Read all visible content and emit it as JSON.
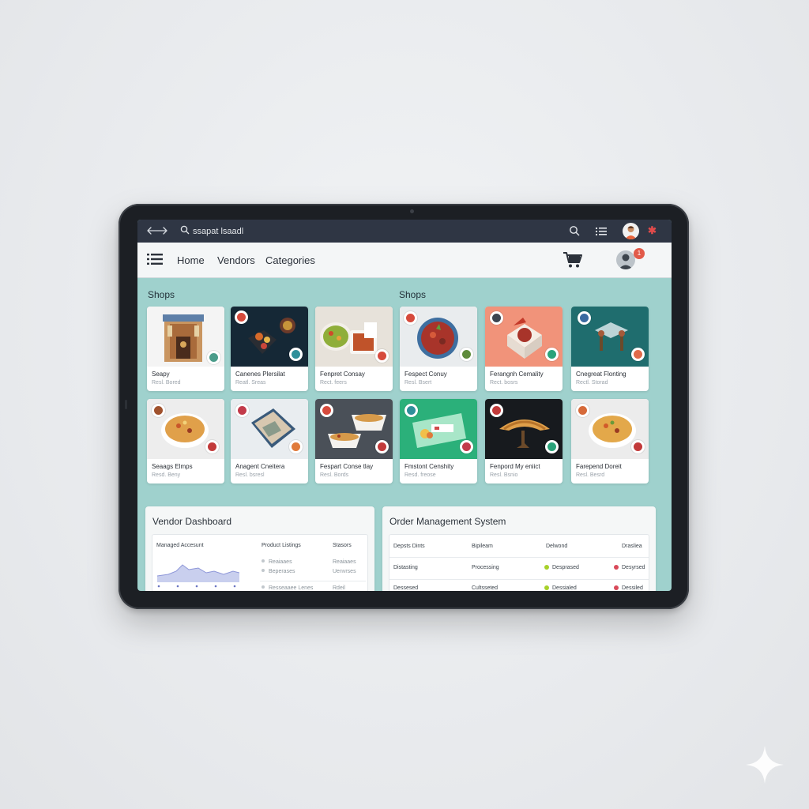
{
  "topbar": {
    "search_text": "ssapat lsaadl"
  },
  "nav": {
    "home": "Home",
    "vendors": "Vendors",
    "categories": "Categories",
    "notification_count": "1"
  },
  "sections": {
    "shops_left": "Shops",
    "shops_right": "Shops"
  },
  "cards": [
    {
      "title": "Seapy",
      "sub": "Resl. Bored",
      "badge_color": "#4a9c8a"
    },
    {
      "title": "Canenes Plersilat",
      "sub": "Reatl. Sreas",
      "badge_color": "#2f8f9a"
    },
    {
      "title": "Fenpret Consay",
      "sub": "Rect. feers",
      "badge_color": "#d64a3c"
    },
    {
      "title": "Fespect Conuy",
      "sub": "Resl. Bsert",
      "badge_color": "#5d8a3a"
    },
    {
      "title": "Ferangnh Cemality",
      "sub": "Rect. bosrs",
      "badge_color": "#2aa37a"
    },
    {
      "title": "Cnegreat Flonting",
      "sub": "Rectl. Storad",
      "badge_color": "#e06a4a"
    },
    {
      "title": "Seaags Elmps",
      "sub": "Resd. Beny",
      "badge_color": "#c23a3a"
    },
    {
      "title": "Anagent Cneitera",
      "sub": "Resl. bsresl",
      "badge_color": "#e07a3a"
    },
    {
      "title": "Fespart Conse tlay",
      "sub": "Resl. Bords",
      "badge_color": "#c23a3a"
    },
    {
      "title": "Fmstont Censhity",
      "sub": "Resd. freose",
      "badge_color": "#c23a4a"
    },
    {
      "title": "Fenpord My eniict",
      "sub": "Resl. Bsnio",
      "badge_color": "#2aa37a"
    },
    {
      "title": "Farepend Doreit",
      "sub": "Resl. Besrd",
      "badge_color": "#c23a3a"
    }
  ],
  "vendor_dashboard": {
    "title": "Vendor Dashboard",
    "col1": "Managed Accesunt",
    "col2": "Product Listings",
    "col3": "Stasors",
    "rows": [
      {
        "product": "Reaiaaes",
        "status": "Reaiaaes"
      },
      {
        "product": "Beperases",
        "status": "Uenvrses"
      },
      {
        "product": "Resseaaee Lenes",
        "status": "Rdeil"
      }
    ]
  },
  "order_management": {
    "title": "Order Management System",
    "headers": [
      "Depsts Dints",
      "Bipileam",
      "Delwond",
      "Drasliea"
    ],
    "rows": [
      {
        "c1": "Distasting",
        "c2": "Processing",
        "c3": "Desprased",
        "c3_color": "#a7d12a",
        "c4": "Desyrsed",
        "c4_color": "#d94a5a"
      },
      {
        "c1": "Dessesed",
        "c2": "Cultsseted",
        "c3": "Dessialed",
        "c3_color": "#a7d12a",
        "c4": "Dessiled",
        "c4_color": "#d94a5a"
      }
    ]
  }
}
